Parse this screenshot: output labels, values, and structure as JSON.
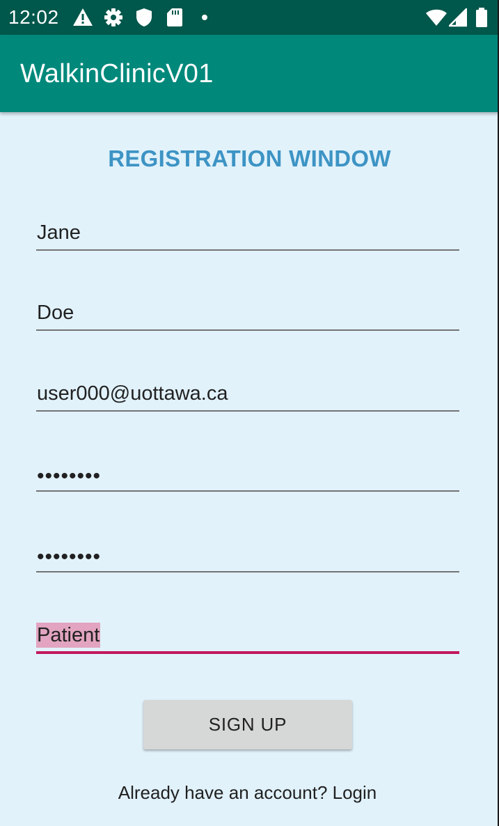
{
  "status_bar": {
    "time": "12:02",
    "icons": [
      "warning-icon",
      "settings-icon",
      "shield-icon",
      "sd-card-icon",
      "notification-dot-icon",
      "wifi-icon",
      "cell-signal-icon",
      "battery-icon"
    ]
  },
  "app_bar": {
    "title": "WalkinClinicV01"
  },
  "form": {
    "heading": "REGISTRATION WINDOW",
    "first_name": "Jane",
    "last_name": "Doe",
    "email": "user000@uottawa.ca",
    "password": "••••••••",
    "confirm_password": "••••••••",
    "role": "Patient",
    "signup_label": "SIGN UP",
    "login_text": "Already have an account? Login"
  },
  "colors": {
    "status_bar": "#00574b",
    "app_bar": "#00897b",
    "background": "#e1f2fb",
    "heading": "#3d94c4",
    "accent": "#c2185b"
  }
}
